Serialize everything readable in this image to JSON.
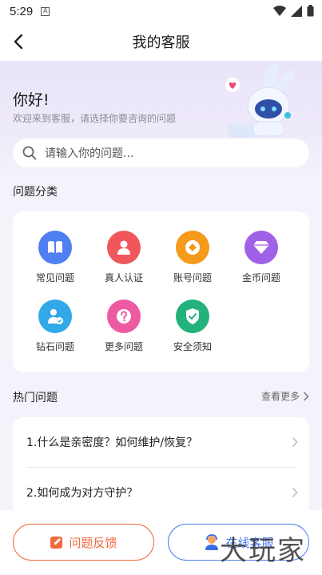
{
  "status": {
    "time": "5:29",
    "note": "A"
  },
  "header": {
    "title": "我的客服"
  },
  "greeting": {
    "title": "你好!",
    "subtitle": "欢迎来到客服，请选择你要咨询的问题"
  },
  "search": {
    "placeholder": "请输入你的问题..."
  },
  "categories": {
    "title": "问题分类",
    "items": [
      {
        "label": "常见问题",
        "icon": "book-icon",
        "color": "#4f7ff0"
      },
      {
        "label": "真人认证",
        "icon": "person-icon",
        "color": "#f0575b"
      },
      {
        "label": "账号问题",
        "icon": "coin-square-icon",
        "color": "#f59a1b"
      },
      {
        "label": "金币问题",
        "icon": "diamond-gem-icon",
        "color": "#a060e8"
      },
      {
        "label": "钻石问题",
        "icon": "user-check-icon",
        "color": "#33a8e8"
      },
      {
        "label": "更多问题",
        "icon": "question-icon",
        "color": "#ee5aa0"
      },
      {
        "label": "安全须知",
        "icon": "shield-check-icon",
        "color": "#23b27a"
      }
    ]
  },
  "hot": {
    "title": "热门问题",
    "more_label": "查看更多",
    "items": [
      {
        "label": "1.什么是亲密度？如何维护/恢复？"
      },
      {
        "label": "2.如何成为对方守护？"
      }
    ]
  },
  "actions": {
    "feedback_label": "问题反馈",
    "service_label": "在线客服"
  },
  "watermark": "大玩家"
}
